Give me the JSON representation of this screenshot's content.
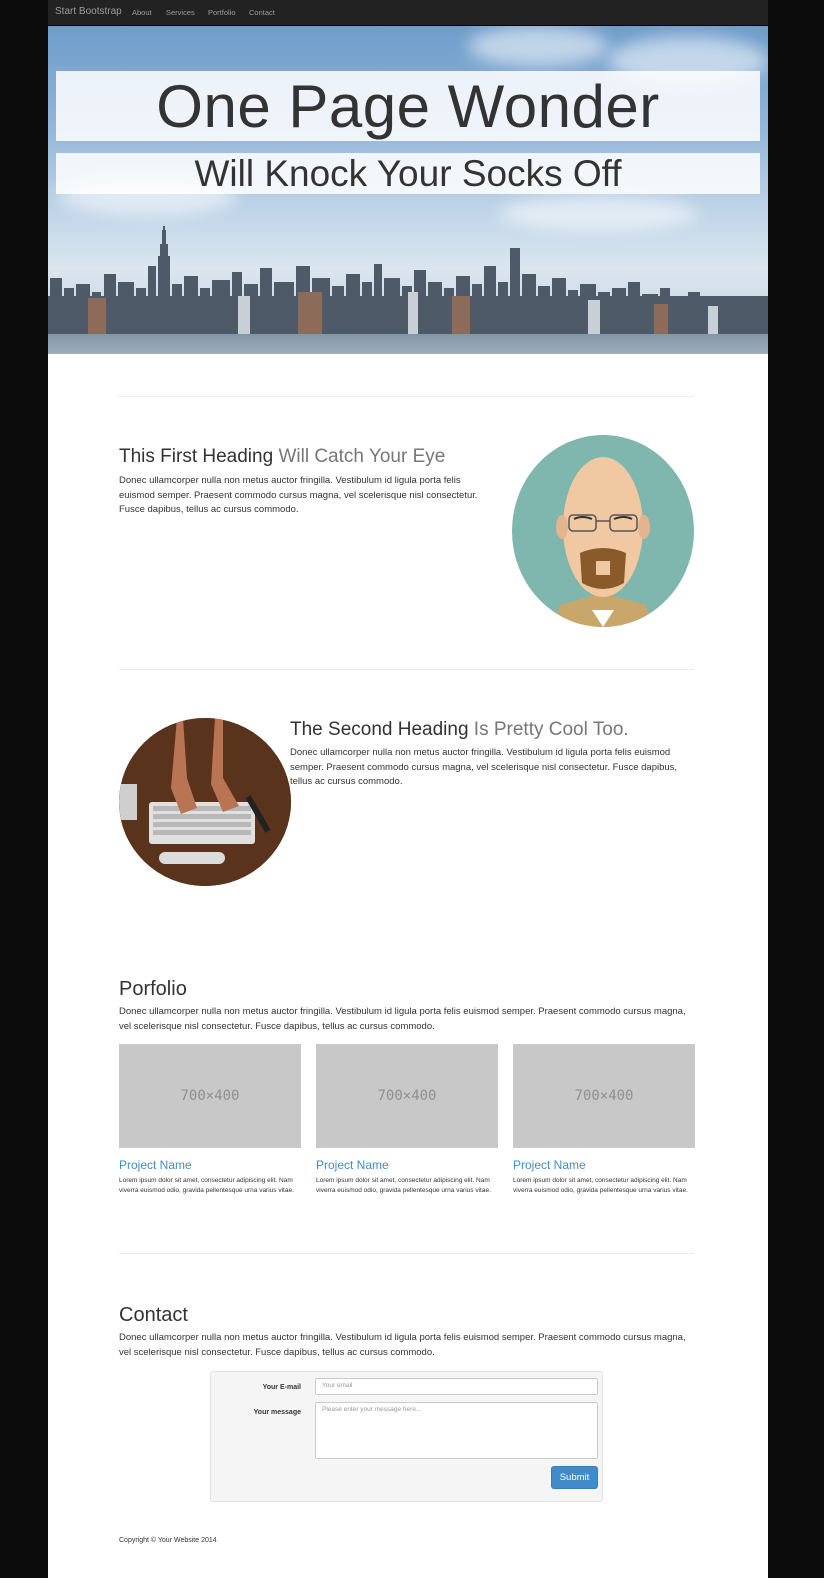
{
  "navbar": {
    "brand": "Start Bootstrap",
    "links": [
      "About",
      "Services",
      "Portfolio",
      "Contact"
    ]
  },
  "hero": {
    "title": "One Page Wonder",
    "subtitle": "Will Knock Your Socks Off"
  },
  "feature1": {
    "heading": "This First Heading",
    "heading_muted": "Will Catch Your Eye",
    "text": "Donec ullamcorper nulla non metus auctor fringilla. Vestibulum id ligula porta felis euismod semper. Praesent commodo cursus magna, vel scelerisque nisl consectetur. Fusce dapibus, tellus ac cursus commodo."
  },
  "feature2": {
    "heading": "The Second Heading",
    "heading_muted": "Is Pretty Cool Too.",
    "text": "Donec ullamcorper nulla non metus auctor fringilla. Vestibulum id ligula porta felis euismod semper. Praesent commodo cursus magna, vel scelerisque nisl consectetur. Fusce dapibus, tellus ac cursus commodo."
  },
  "portfolio": {
    "heading": "Porfolio",
    "text": "Donec ullamcorper nulla non metus auctor fringilla. Vestibulum id ligula porta felis euismod semper. Praesent commodo cursus magna, vel scelerisque nisl consectetur. Fusce dapibus, tellus ac cursus commodo.",
    "items": [
      {
        "thumb": "700×400",
        "title": "Project Name",
        "text": "Lorem ipsum dolor sit amet, consectetur adipiscing elit. Nam viverra euismod odio, gravida pellentesque urna varius vitae."
      },
      {
        "thumb": "700×400",
        "title": "Project Name",
        "text": "Lorem ipsum dolor sit amet, consectetur adipiscing elit. Nam viverra euismod odio, gravida pellentesque urna varius vitae."
      },
      {
        "thumb": "700×400",
        "title": "Project Name",
        "text": "Lorem ipsum dolor sit amet, consectetur adipiscing elit. Nam viverra euismod odio, gravida pellentesque urna varius vitae."
      }
    ]
  },
  "contact": {
    "heading": "Contact",
    "text": "Donec ullamcorper nulla non metus auctor fringilla. Vestibulum id ligula porta felis euismod semper. Praesent commodo cursus magna, vel scelerisque nisl consectetur. Fusce dapibus, tellus ac cursus commodo.",
    "email_label": "Your E-mail",
    "email_placeholder": "Your email",
    "message_label": "Your message",
    "message_placeholder": "Please enter your message here...",
    "submit_label": "Submit"
  },
  "footer": {
    "copyright": "Copyright © Your Website 2014"
  },
  "colors": {
    "navbar_bg": "#222222",
    "link_blue": "#428bca",
    "muted_text": "#777777"
  }
}
